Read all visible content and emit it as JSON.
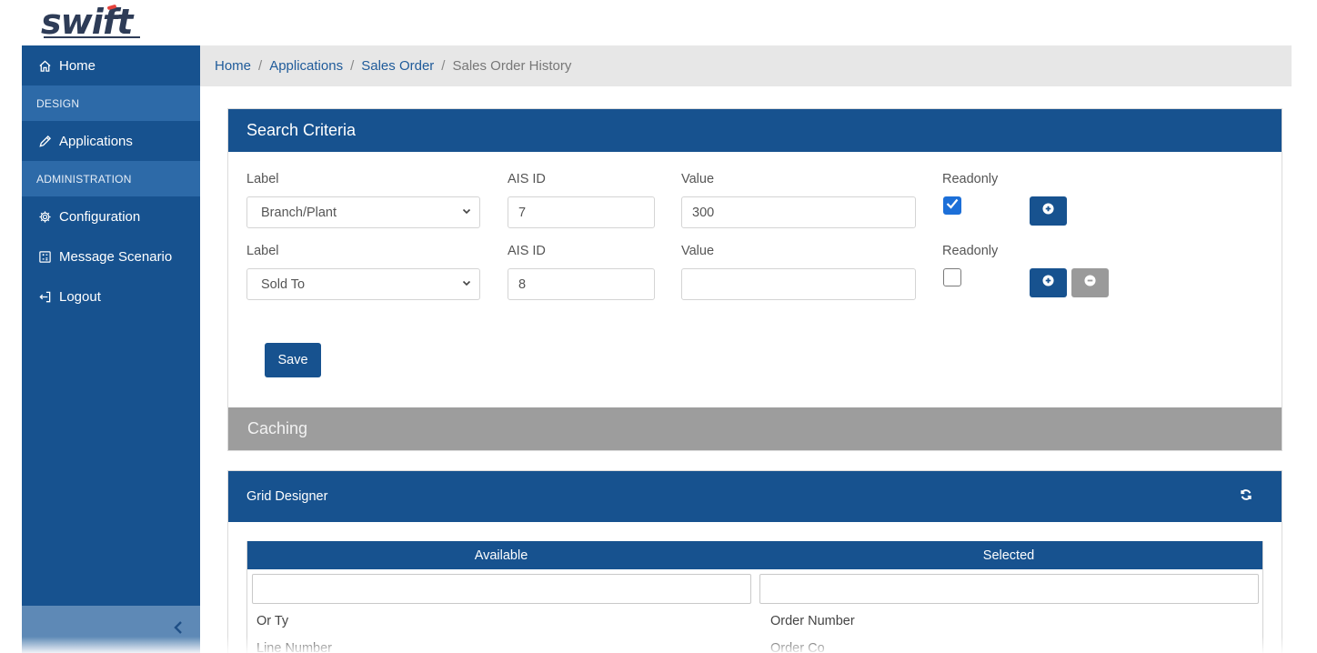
{
  "app": {
    "logo_text": "swift"
  },
  "sidebar": {
    "items": [
      {
        "label": "Home",
        "icon": "home-icon"
      },
      {
        "label": "Applications",
        "icon": "pencil-icon"
      },
      {
        "label": "Configuration",
        "icon": "gear-icon"
      },
      {
        "label": "Message Scenario",
        "icon": "calculator-icon"
      },
      {
        "label": "Logout",
        "icon": "logout-icon"
      }
    ],
    "sections": [
      "DESIGN",
      "ADMINISTRATION"
    ],
    "collapse_icon": "chevron-left-icon"
  },
  "breadcrumb": {
    "items": [
      "Home",
      "Applications",
      "Sales Order"
    ],
    "current": "Sales Order History",
    "separator": "/"
  },
  "search_criteria": {
    "title": "Search Criteria",
    "labels": {
      "label": "Label",
      "ais_id": "AIS ID",
      "value": "Value",
      "readonly": "Readonly"
    },
    "rows": [
      {
        "label": "Branch/Plant",
        "ais_id": "7",
        "value": "300",
        "readonly": true
      },
      {
        "label": "Sold To",
        "ais_id": "8",
        "value": "",
        "readonly": false
      }
    ],
    "save_label": "Save"
  },
  "caching": {
    "title": "Caching"
  },
  "grid_designer": {
    "title": "Grid Designer",
    "columns": [
      "Available",
      "Selected"
    ],
    "available_items": [
      "Or Ty",
      "Line Number"
    ],
    "selected_items": [
      "Order Number",
      "Order Co"
    ]
  },
  "colors": {
    "primary": "#17528f",
    "section": "#2d6aa8",
    "caching": "#9d9d9d",
    "checkbox": "#1c6fd8"
  }
}
